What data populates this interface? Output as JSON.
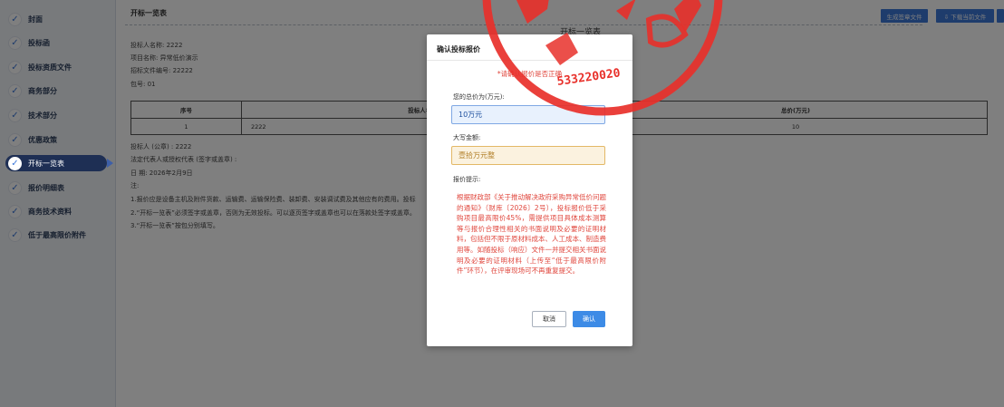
{
  "sidebar": {
    "items": [
      {
        "label": "封面"
      },
      {
        "label": "投标函"
      },
      {
        "label": "投标资质文件"
      },
      {
        "label": "商务部分"
      },
      {
        "label": "技术部分"
      },
      {
        "label": "优惠政策"
      },
      {
        "label": "开标一览表"
      },
      {
        "label": "报价明细表"
      },
      {
        "label": "商务技术资料"
      },
      {
        "label": "低于最高限价附件"
      }
    ],
    "active_index": 6,
    "check_glyph": "✓"
  },
  "document": {
    "title": "开标一览表",
    "center_title": "开标一览表",
    "toolbar": {
      "generate_label": "生成签章文件",
      "download_label": "⇩ 下载当前文件"
    },
    "info": [
      "投标人名称: 2222",
      "项目名称: 异常低价演示",
      "招标文件编号: 22222",
      "包号: 01"
    ],
    "table": {
      "headers": [
        "序号",
        "投标人名称",
        "总价(万元)"
      ],
      "rows": [
        [
          "1",
          "2222",
          "10"
        ]
      ]
    },
    "signatures": [
      "投标人 (公章) : 2222",
      "法定代表人或授权代表 (签字或盖章) :",
      "日  期: 2026年2月9日",
      "注:"
    ],
    "notes": [
      "1.报价应是设备主机及附件货款、运输费、运输保险费、装卸费、安装调试费及其他应有的费用。投标",
      "2.“开标一览表”必须签字或盖章，否则为无效投标。可以逐页签字或盖章也可以在落款处签字或盖章。",
      "3.“开标一览表”按包分别填写。"
    ]
  },
  "seal": {
    "number_text": "533220020"
  },
  "dialog": {
    "title": "确认投标报价",
    "warning": "*请确认报价是否正确",
    "total_label": "您的总价为(万元):",
    "total_value": "10万元",
    "uppercase_label": "大写金额:",
    "uppercase_value": "壹拾万元整",
    "hint_label": "报价提示:",
    "hint_text": "根据财政部《关于推动解决政府采购异常低价问题的通知》（财库〔2026〕2号），投标报价低于采购项目最高限价45%，需提供项目具体成本测算等与报价合理性相关的书面说明及必要的证明材料，包括但不限于原材料成本、人工成本、制造费用等。如随投标（响应）文件一并提交相关书面说明及必要的证明材料（上传至“低于最高限价附件”环节），在评审现场可不再重复提交。",
    "cancel_label": "取消",
    "confirm_label": "确认"
  },
  "colors": {
    "accent": "#3d78d8",
    "sidebar_active": "#3d5fa8",
    "warning": "#e0463c",
    "seal": "#e8302a"
  }
}
